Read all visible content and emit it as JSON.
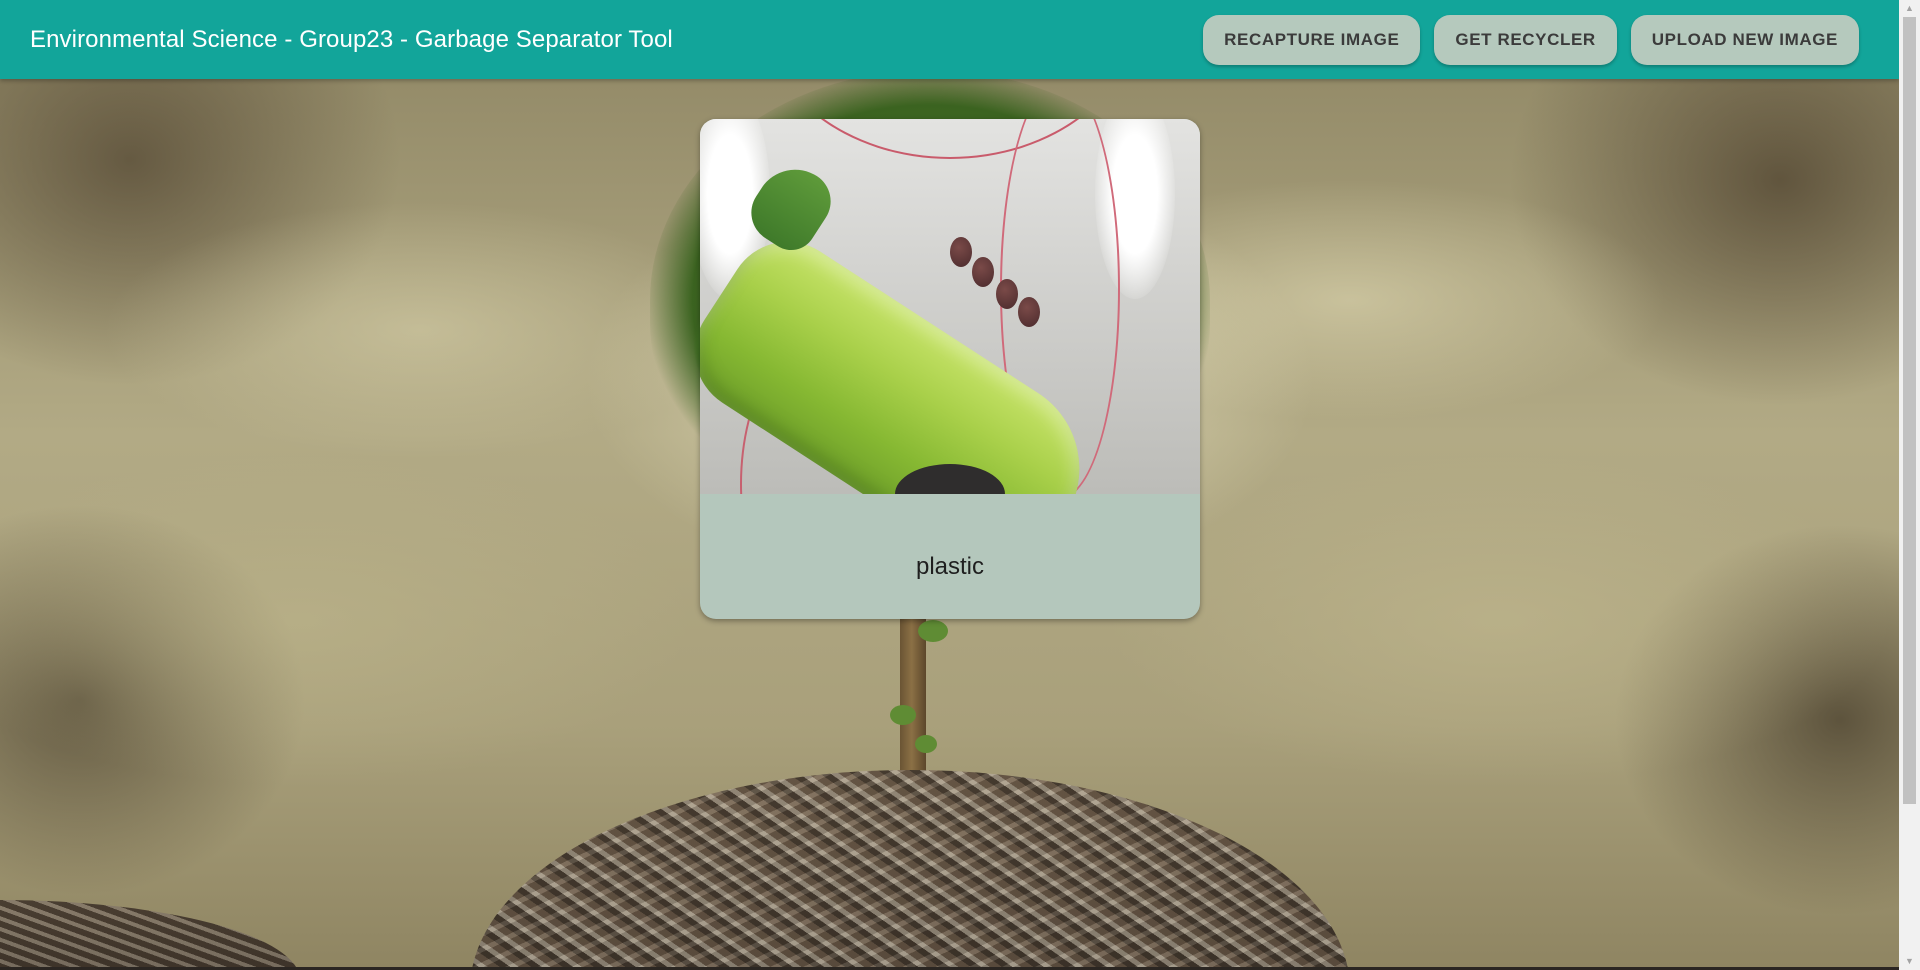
{
  "appbar": {
    "title": "Environmental Science - Group23 - Garbage Separator Tool",
    "background_color": "#12a59a",
    "actions": [
      {
        "label": "RECAPTURE IMAGE"
      },
      {
        "label": "GET RECYCLER"
      },
      {
        "label": "UPLOAD NEW IMAGE"
      }
    ]
  },
  "result": {
    "label": "plastic",
    "photo_subject": "green-plastic-bottle"
  },
  "background": {
    "subject": "tree-growing-from-garbage-heap"
  },
  "colors": {
    "button_bg": "#b5c9bd",
    "card_bg": "#b4c7bc"
  },
  "scrollbar": {
    "up_icon": "chevron-up-icon",
    "down_icon": "chevron-down-icon"
  }
}
